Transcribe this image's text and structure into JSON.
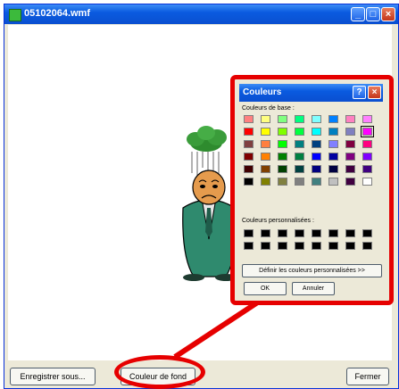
{
  "window": {
    "title": "05102064.wmf",
    "minimize": "_",
    "maximize": "□",
    "close": "×"
  },
  "footer": {
    "save_label": "Enregistrer sous...",
    "bgcolor_label": "Couleur de fond",
    "close_label": "Fermer"
  },
  "dialog": {
    "title": "Couleurs",
    "help": "?",
    "close": "×",
    "basic_label": "Couleurs de base :",
    "custom_label": "Couleurs personnalisées :",
    "define_label": "Définir les couleurs personnalisées >>",
    "ok_label": "OK",
    "cancel_label": "Annuler",
    "basic_colors": [
      [
        "#ff8080",
        "#ffff80",
        "#80ff80",
        "#00ff80",
        "#80ffff",
        "#0080ff",
        "#ff80c0",
        "#ff80ff"
      ],
      [
        "#ff0000",
        "#ffff00",
        "#80ff00",
        "#00ff40",
        "#00ffff",
        "#0080c0",
        "#8080c0",
        "#ff00ff"
      ],
      [
        "#804040",
        "#ff8040",
        "#00ff00",
        "#008080",
        "#004080",
        "#8080ff",
        "#800040",
        "#ff0080"
      ],
      [
        "#800000",
        "#ff8000",
        "#008000",
        "#008040",
        "#0000ff",
        "#0000a0",
        "#800080",
        "#8000ff"
      ],
      [
        "#400000",
        "#804000",
        "#004000",
        "#004040",
        "#000080",
        "#000040",
        "#400040",
        "#400080"
      ],
      [
        "#000000",
        "#808000",
        "#808040",
        "#808080",
        "#408080",
        "#c0c0c0",
        "#400040",
        "#ffffff"
      ]
    ],
    "selected_index": 15,
    "custom_colors": [
      [
        "#000000",
        "#000000",
        "#000000",
        "#000000",
        "#000000",
        "#000000",
        "#000000",
        "#000000"
      ],
      [
        "#000000",
        "#000000",
        "#000000",
        "#000000",
        "#000000",
        "#000000",
        "#000000",
        "#000000"
      ]
    ]
  }
}
